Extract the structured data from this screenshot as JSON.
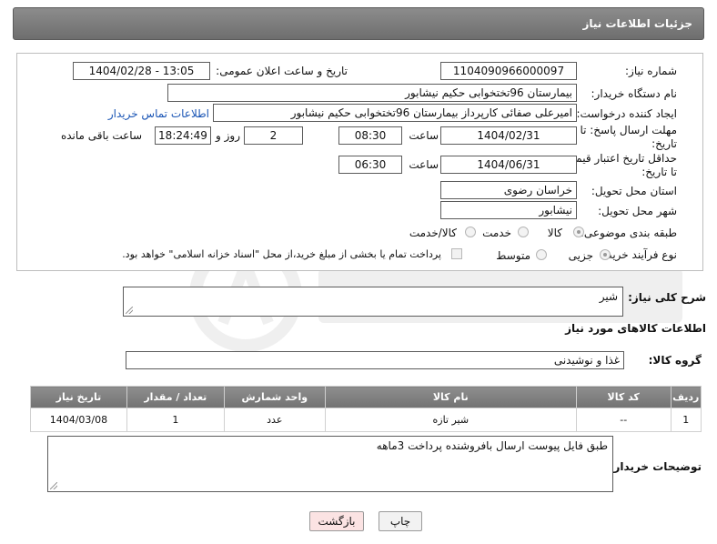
{
  "header": {
    "title": "جزئیات اطلاعات نیاز"
  },
  "form": {
    "need_number_label": "شماره نیاز:",
    "need_number": "1104090966000097",
    "announce_label": "تاریخ و ساعت اعلان عمومی:",
    "announce_value": "1404/02/28 - 13:05",
    "buyer_org_label": "نام دستگاه خریدار:",
    "buyer_org": "بیمارستان 96تختخوابی حکیم نیشابور",
    "creator_label": "ایجاد کننده درخواست:",
    "creator": "امیرعلی صفائی کارپرداز بیمارستان 96تختخوابی حکیم نیشابور",
    "contact_link": "اطلاعات تماس خریدار",
    "deadline_label_1": "مهلت ارسال پاسخ: تا",
    "deadline_label_2": "تاریخ:",
    "deadline_date": "1404/02/31",
    "time_label": "ساعت",
    "deadline_time": "08:30",
    "days_value": "2",
    "days_label": "روز و",
    "remaining_time": "18:24:49",
    "remaining_label": "ساعت باقی مانده",
    "validity_label_1": "حداقل تاریخ اعتبار قیمت:",
    "validity_label_2": "تا تاریخ:",
    "validity_date": "1404/06/31",
    "validity_time": "06:30",
    "province_label": "استان محل تحویل:",
    "province": "خراسان رضوی",
    "city_label": "شهر محل تحویل:",
    "city": "نیشابور",
    "category_label": "طبقه بندی موضوعی:",
    "category_options": [
      "کالا",
      "خدمت",
      "کالا/خدمت"
    ],
    "process_label": "نوع فرآیند خرید :",
    "process_options": [
      "جزیی",
      "متوسط"
    ],
    "payment_note": "پرداخت تمام یا بخشی از مبلغ خرید،از محل \"اسناد خزانه اسلامی\" خواهد بود."
  },
  "description": {
    "label": "شرح کلی نیاز:",
    "value": "شیر"
  },
  "goods": {
    "section_title": "اطلاعات کالاهای مورد نیاز",
    "group_label": "گروه کالا:",
    "group_value": "غذا و نوشیدنی",
    "columns": [
      "ردیف",
      "کد کالا",
      "نام کالا",
      "واحد شمارش",
      "تعداد / مقدار",
      "تاریخ نیاز"
    ],
    "rows": [
      {
        "row": "1",
        "code": "--",
        "name": "شیر تازه",
        "unit": "عدد",
        "qty": "1",
        "date": "1404/03/08"
      }
    ]
  },
  "buyer_notes": {
    "label": "توضیحات خریدار:",
    "value": "طبق فایل پیوست ارسال بافروشنده پرداخت 3ماهه"
  },
  "buttons": {
    "print": "چاپ",
    "back": "بازگشت"
  },
  "colors": {
    "header_bg": "#7d7d7d",
    "link": "#1a55b5",
    "back_button": "#fbe3e3"
  }
}
